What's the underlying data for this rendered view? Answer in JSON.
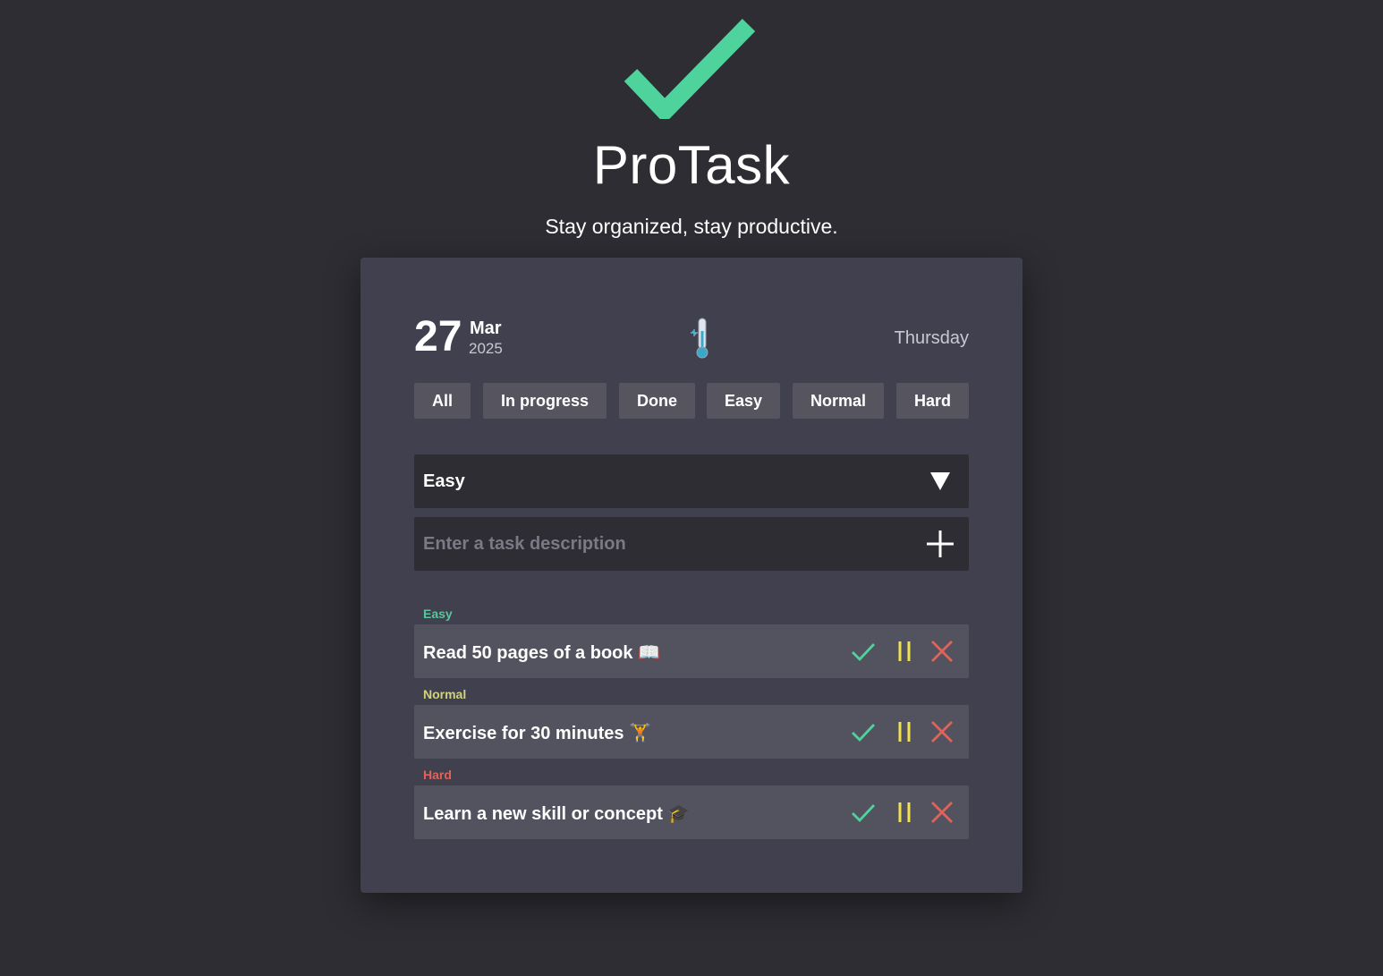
{
  "app": {
    "title": "ProTask",
    "tagline": "Stay organized, stay productive."
  },
  "colors": {
    "background": "#2e2d33",
    "card": "#41404f",
    "accent_green": "#4fd39c",
    "easy": "#5ac49a",
    "normal": "#d0d37a",
    "hard": "#e0635a",
    "pause": "#f0e24e",
    "delete": "#e0635a"
  },
  "header": {
    "day": "27",
    "month": "Mar",
    "year": "2025",
    "weekday": "Thursday",
    "weather_icon": "thermometer-icon"
  },
  "filters": [
    "All",
    "In progress",
    "Done",
    "Easy",
    "Normal",
    "Hard"
  ],
  "form": {
    "difficulty_selected": "Easy",
    "input_placeholder": "Enter a task description",
    "input_value": ""
  },
  "tasks": [
    {
      "level": "Easy",
      "text": "Read 50 pages of a book 📖"
    },
    {
      "level": "Normal",
      "text": "Exercise for 30 minutes 🏋️"
    },
    {
      "level": "Hard",
      "text": "Learn a new skill or concept 🎓"
    }
  ]
}
